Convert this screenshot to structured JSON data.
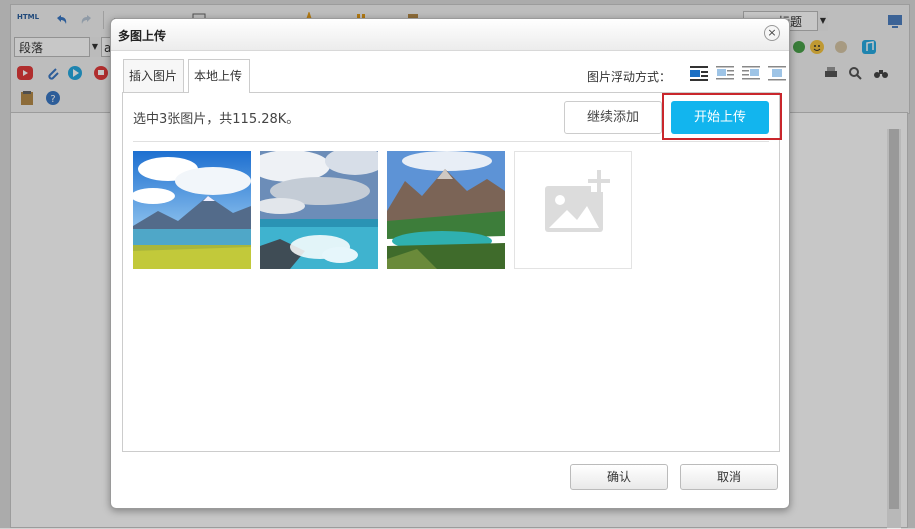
{
  "editor": {
    "html_label": "HTML",
    "paragraph_select": "段落",
    "font_select_partial": "a",
    "title_select_partial": "标题"
  },
  "dialog": {
    "title": "多图上传",
    "close_glyph": "×",
    "tabs": [
      {
        "label": "插入图片",
        "active": false
      },
      {
        "label": "本地上传",
        "active": true
      }
    ],
    "float_label": "图片浮动方式：",
    "float_options": [
      "default",
      "left",
      "right",
      "center"
    ],
    "status": "选中3张图片，共115.28K。",
    "continue_label": "继续添加",
    "start_label": "开始上传",
    "thumbnails": [
      "lake-mountains",
      "ocean-waves",
      "mountain-lake"
    ],
    "confirm_label": "确认",
    "cancel_label": "取消"
  },
  "colors": {
    "accent": "#12b5ee",
    "highlight": "#c9262c"
  }
}
